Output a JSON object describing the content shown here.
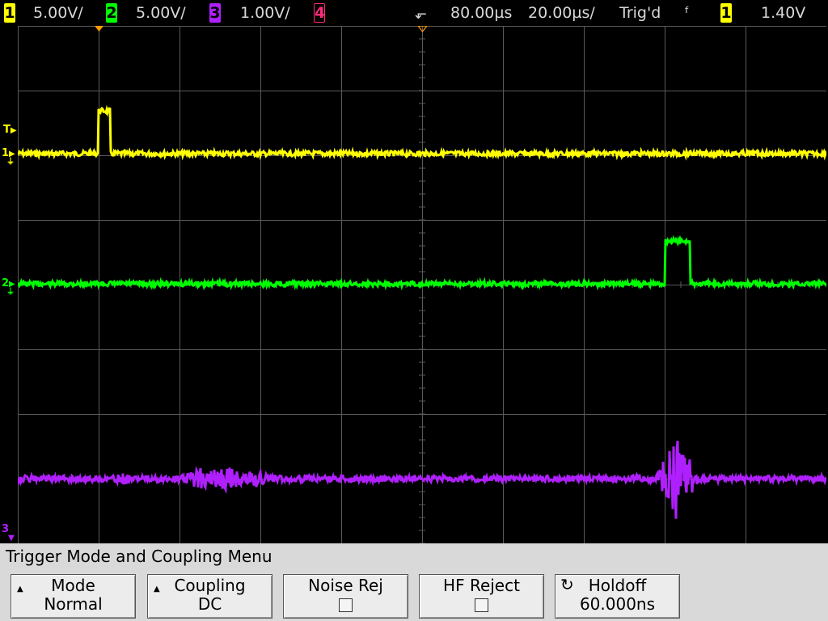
{
  "topbar": {
    "ch1": {
      "num": "1",
      "scale": "5.00V/",
      "color": "#ffff00"
    },
    "ch2": {
      "num": "2",
      "scale": "5.00V/",
      "color": "#00ff00"
    },
    "ch3": {
      "num": "3",
      "scale": "1.00V/",
      "color": "#b020ff"
    },
    "ch4": {
      "num": "4",
      "color": "#ff2a7a"
    },
    "delay": "80.00µs",
    "timebase": "20.00µs/",
    "trig_status": "Trig'd",
    "trig_source": "1",
    "trig_level": "1.40V"
  },
  "markers": {
    "trigger": "T",
    "ch1": "1",
    "ch2": "2",
    "ch3": "3"
  },
  "menu": {
    "title": "Trigger Mode and Coupling Menu",
    "keys": [
      {
        "label": "Mode",
        "value": "Normal"
      },
      {
        "label": "Coupling",
        "value": "DC"
      },
      {
        "label": "Noise Rej",
        "value": ""
      },
      {
        "label": "HF Reject",
        "value": ""
      },
      {
        "label": "Holdoff",
        "value": "60.000ns"
      }
    ]
  },
  "colors": {
    "ch1": "#ffff00",
    "ch2": "#00ff00",
    "ch3": "#b020ff",
    "grid": "#5a5a5a",
    "trigger_marker": "#ff9900",
    "menu_bg": "#d9d9d9"
  }
}
